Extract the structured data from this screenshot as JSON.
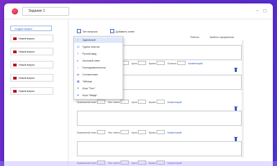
{
  "window": {
    "tab_title": "Задание 1",
    "controls": [
      "–",
      "◻"
    ]
  },
  "sidebar": {
    "create_label": "Создать вопрос",
    "items": [
      {
        "label": "Новый вопрос"
      },
      {
        "label": "Новый вопрос"
      },
      {
        "label": "Новый вопрос"
      },
      {
        "label": "Новый вопрос"
      },
      {
        "label": "Новый вопрос"
      }
    ]
  },
  "toolbar": {
    "type_label": "Тип вопроса",
    "add_answer_label": "Добавить ответ"
  },
  "header": {
    "rating": "Рейтинг",
    "scoring": "Шаблон оформления"
  },
  "dropdown": {
    "items": [
      {
        "icon": "✓",
        "label": "Одиночный",
        "selected": true
      },
      {
        "icon": "☑",
        "label": "Группа ответов",
        "selected": false
      },
      {
        "icon": "T",
        "label": "Ручной ввод",
        "selected": false
      },
      {
        "icon": "#",
        "label": "Числовой ответ",
        "selected": false
      },
      {
        "icon": "↕",
        "label": "Последовательность",
        "selected": false
      },
      {
        "icon": "⇄",
        "label": "Соответствие",
        "selected": false
      },
      {
        "icon": "▦",
        "label": "Таблица",
        "selected": false
      },
      {
        "icon": "✕",
        "label": "Игра \"Тест\"",
        "selected": false
      },
      {
        "icon": "⊕",
        "label": "Игра \"Найди\"",
        "selected": false
      }
    ]
  },
  "answer_rows": [
    {
      "correct": "Правильный ответ",
      "question": "Вес ответа",
      "cost": "Цена",
      "time": "Время",
      "points": "Попытки",
      "link": "Комментарий"
    },
    {
      "correct": "Правильный ответ",
      "question": "Вес ответа",
      "cost": "Цена",
      "time": "Время",
      "points": "",
      "link": "Комментарий"
    },
    {
      "correct": "Правильный ответ",
      "question": "Вес ответа",
      "cost": "Цена",
      "time": "Время",
      "points": "",
      "link": "Комментарий"
    },
    {
      "correct": "Правильный ответ",
      "question": "Вес ответа",
      "cost": "Цена",
      "time": "Время",
      "points": "",
      "link": "Комментарий"
    }
  ]
}
